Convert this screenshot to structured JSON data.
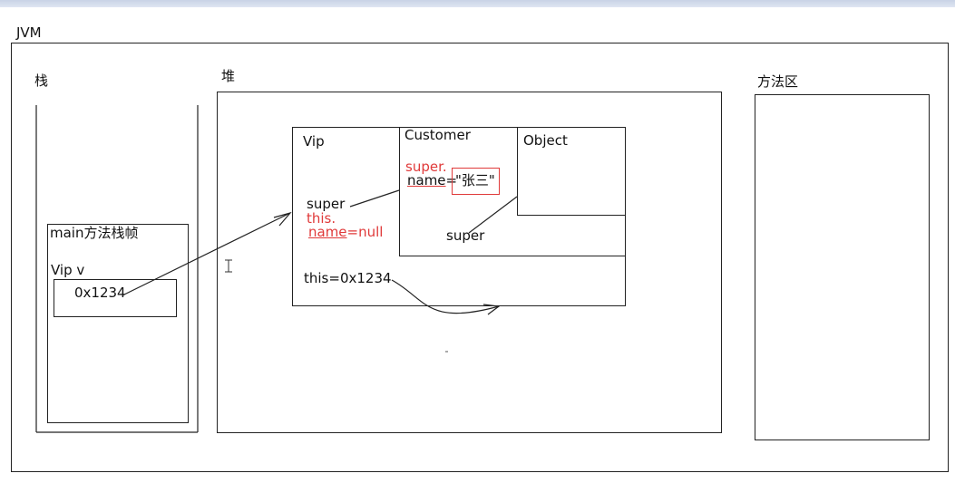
{
  "jvm": {
    "label": "JVM"
  },
  "stack": {
    "label": "栈",
    "frame_label": "main方法栈帧",
    "var_label": "Vip v",
    "var_value": "0x1234"
  },
  "heap": {
    "label": "堆",
    "vip": {
      "label": "Vip",
      "super_text": "super",
      "this_prefix": "this.",
      "name_field": "name",
      "name_value": "=null",
      "this_ref": "this=0x1234"
    },
    "customer": {
      "label": "Customer",
      "super_prefix": "super.",
      "name_field": "name",
      "name_eq": "=",
      "name_value": "\"张三\"",
      "super_text": "super"
    },
    "object": {
      "label": "Object"
    }
  },
  "method_area": {
    "label": "方法区"
  },
  "colors": {
    "annotation": "#e03a3a",
    "ink": "#111111"
  }
}
